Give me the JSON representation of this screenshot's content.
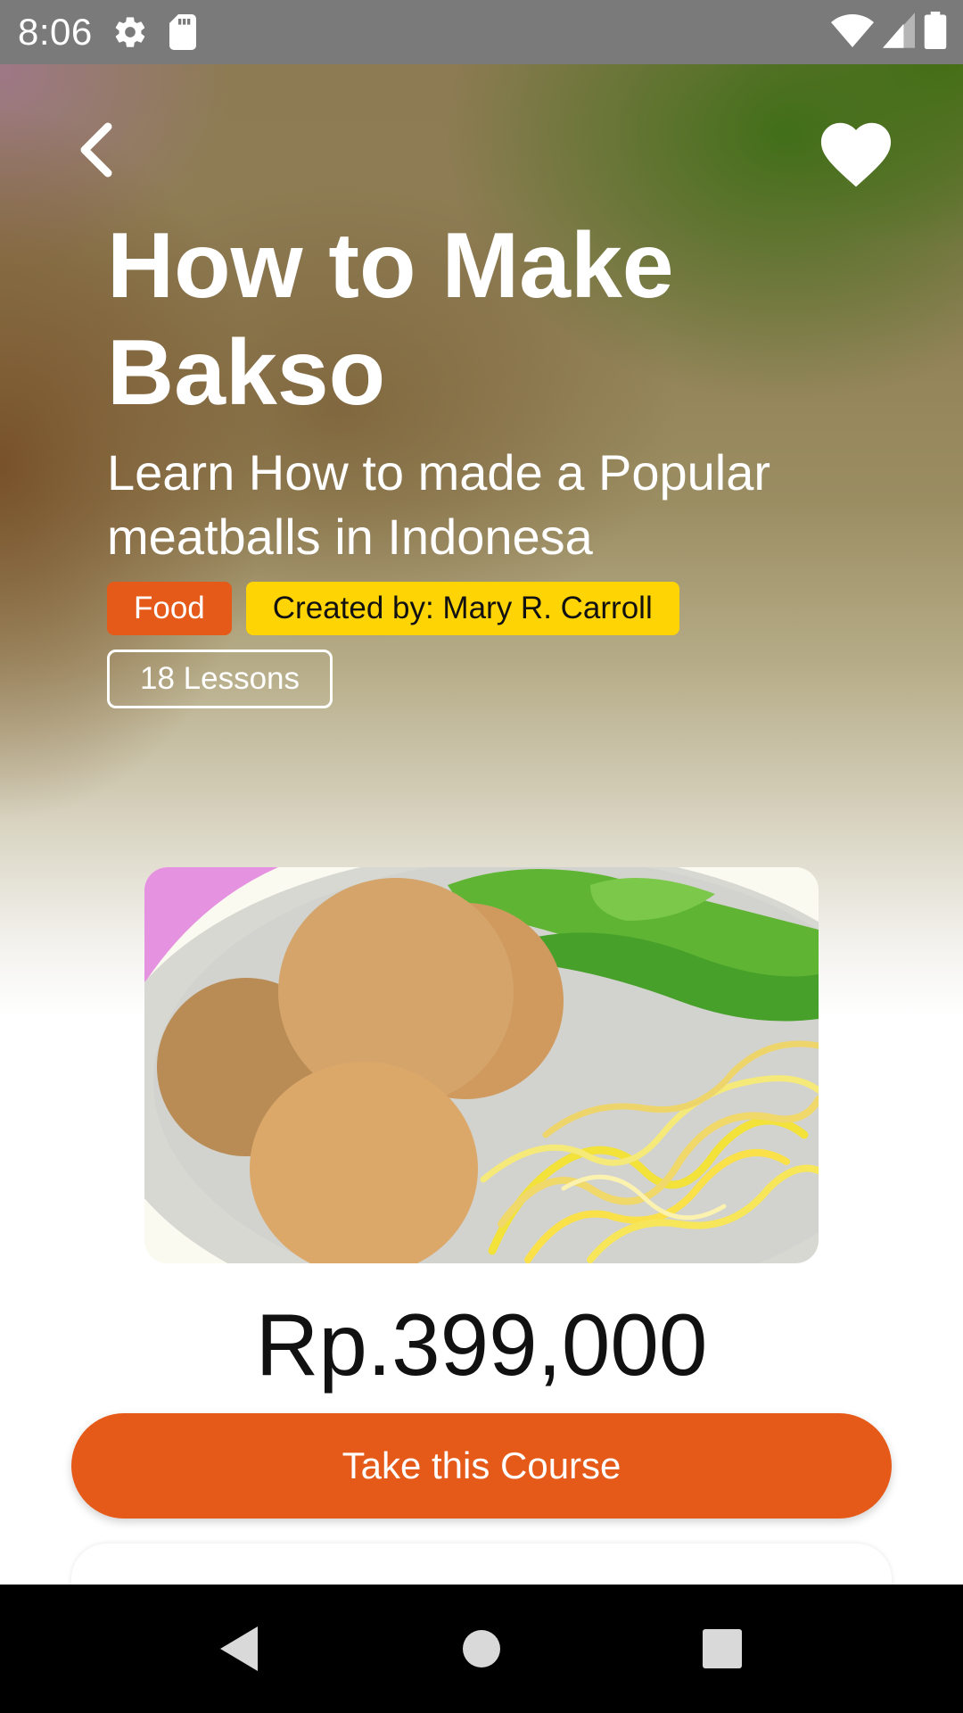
{
  "status_bar": {
    "time": "8:06",
    "icons": [
      "gear-icon",
      "sd-card-icon",
      "wifi-icon",
      "cell-signal-icon",
      "battery-icon"
    ]
  },
  "header": {
    "back_icon": "chevron-left-icon",
    "favorite_icon": "heart-icon"
  },
  "course": {
    "title": "How to Make Bakso",
    "subtitle": "Learn How to made a Popular meatballs in Indonesa",
    "category": "Food",
    "author": "Created by: Mary R. Carroll",
    "lessons": "18 Lessons",
    "price": "Rp.399,000",
    "cta_label": "Take this Course"
  },
  "colors": {
    "accent": "#e65a19",
    "author_tag": "#ffd404",
    "status_bar": "#7a7a7a",
    "nav_bar": "#000000"
  },
  "nav_bar": {
    "icons": [
      "nav-back-icon",
      "nav-home-icon",
      "nav-recents-icon"
    ]
  }
}
